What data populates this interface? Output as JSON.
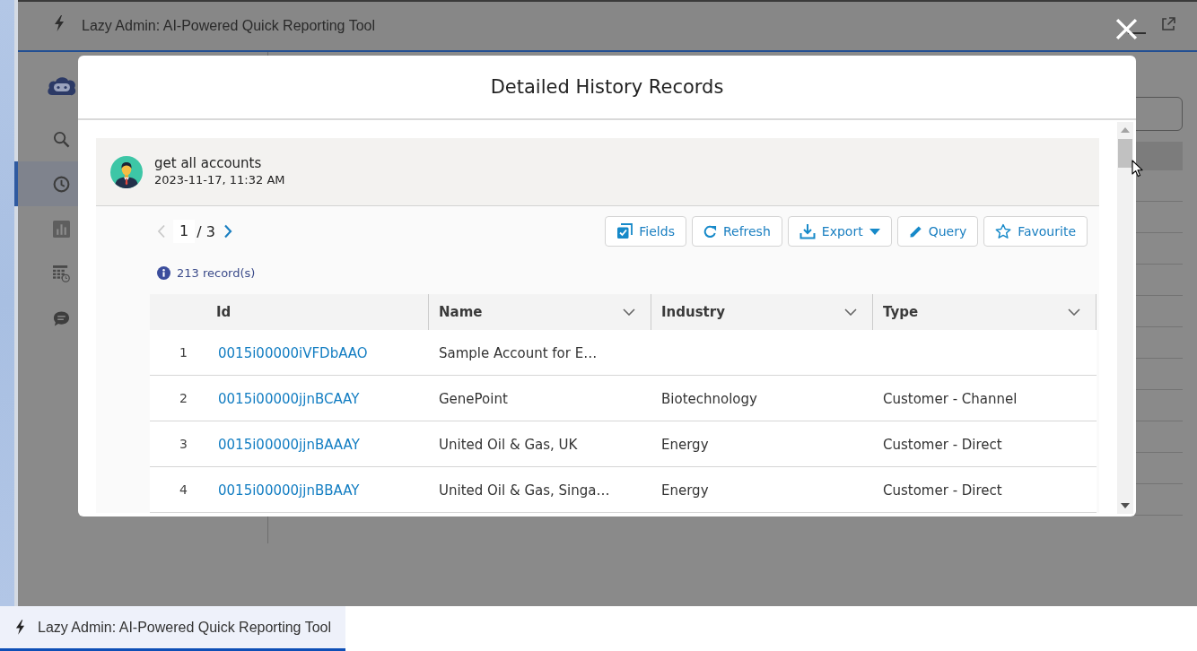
{
  "window": {
    "title": "Lazy Admin: AI-Powered Quick Reporting Tool"
  },
  "sidebar": {
    "items": [
      {
        "kind": "search",
        "selected": false
      },
      {
        "kind": "history",
        "selected": true
      },
      {
        "kind": "reports",
        "selected": false
      },
      {
        "kind": "schedule",
        "selected": false
      },
      {
        "kind": "chat",
        "selected": false
      }
    ]
  },
  "modal": {
    "title": "Detailed History Records",
    "entry": {
      "query": "get all accounts",
      "timestamp": "2023-11-17, 11:32 AM"
    },
    "pagination": {
      "page": "1",
      "total": "/ 3",
      "previous_disabled": true,
      "next_disabled": false
    },
    "toolbar": [
      {
        "kind": "fields",
        "label": "Fields",
        "dropdown": false
      },
      {
        "kind": "refresh",
        "label": "Refresh",
        "dropdown": false
      },
      {
        "kind": "export",
        "label": "Export",
        "dropdown": true
      },
      {
        "kind": "query",
        "label": "Query",
        "dropdown": false
      },
      {
        "kind": "favourite",
        "label": "Favourite",
        "dropdown": false
      }
    ],
    "record_count": "213 record(s)",
    "table": {
      "columns": [
        {
          "label": "Id",
          "kind": "link",
          "menu": false
        },
        {
          "label": "Name",
          "kind": "text",
          "menu": true
        },
        {
          "label": "Industry",
          "kind": "text",
          "menu": true
        },
        {
          "label": "Type",
          "kind": "text",
          "menu": true
        }
      ],
      "rows": [
        {
          "number": "1",
          "cells": [
            "0015i00000iVFDbAAO",
            "Sample Account for E…"
          ]
        },
        {
          "number": "2",
          "cells": [
            "0015i00000jjnBCAAY",
            "GenePoint",
            "Biotechnology",
            "Customer - Channel"
          ]
        },
        {
          "number": "3",
          "cells": [
            "0015i00000jjnBAAAY",
            "United Oil & Gas, UK",
            "Energy",
            "Customer - Direct"
          ]
        },
        {
          "number": "4",
          "cells": [
            "0015i00000jjnBBAAY",
            "United Oil & Gas, Singa…",
            "Energy",
            "Customer - Direct"
          ]
        }
      ]
    }
  },
  "taskbar": {
    "items": [
      {
        "label": "Lazy Admin: AI-Powered Quick Reporting Tool",
        "selected": true
      }
    ]
  }
}
